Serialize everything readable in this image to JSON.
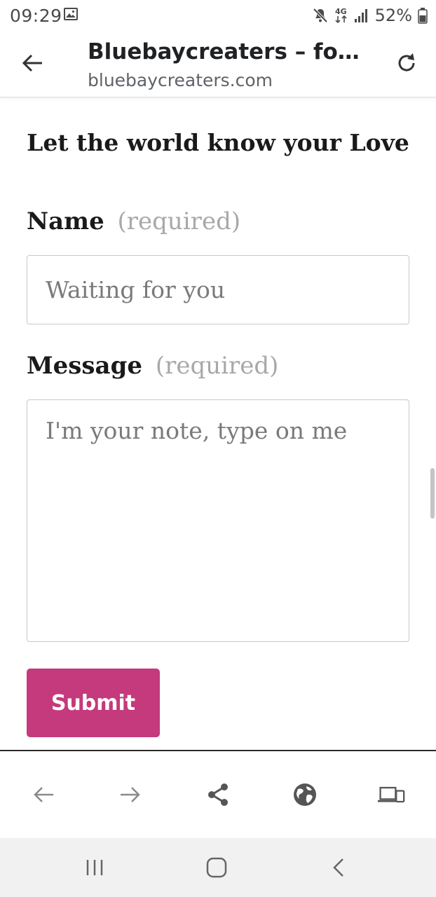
{
  "status_bar": {
    "time": "09:29",
    "network": "4G",
    "battery": "52%",
    "icons": [
      "gallery-icon",
      "mute-icon",
      "network-4g-icon",
      "signal-icon",
      "battery-icon"
    ]
  },
  "toolbar": {
    "title": "Bluebaycreaters – for th...",
    "url": "bluebaycreaters.com",
    "icons": [
      "back-arrow-icon",
      "refresh-icon"
    ]
  },
  "page": {
    "heading": "Let the world know your Love",
    "name_field": {
      "label": "Name",
      "required": "(required)",
      "value": "",
      "placeholder": "Waiting for you"
    },
    "message_field": {
      "label": "Message",
      "required": "(required)",
      "value": "",
      "placeholder": "I'm your note, type on me"
    },
    "submit_label": "Submit",
    "accent_color": "#c43a7c"
  },
  "bottom_nav": {
    "icons": [
      "nav-back-icon",
      "nav-forward-icon",
      "share-icon",
      "globe-icon",
      "devices-icon"
    ]
  },
  "system_nav": {
    "icons": [
      "recents-icon",
      "home-icon",
      "system-back-icon"
    ]
  }
}
